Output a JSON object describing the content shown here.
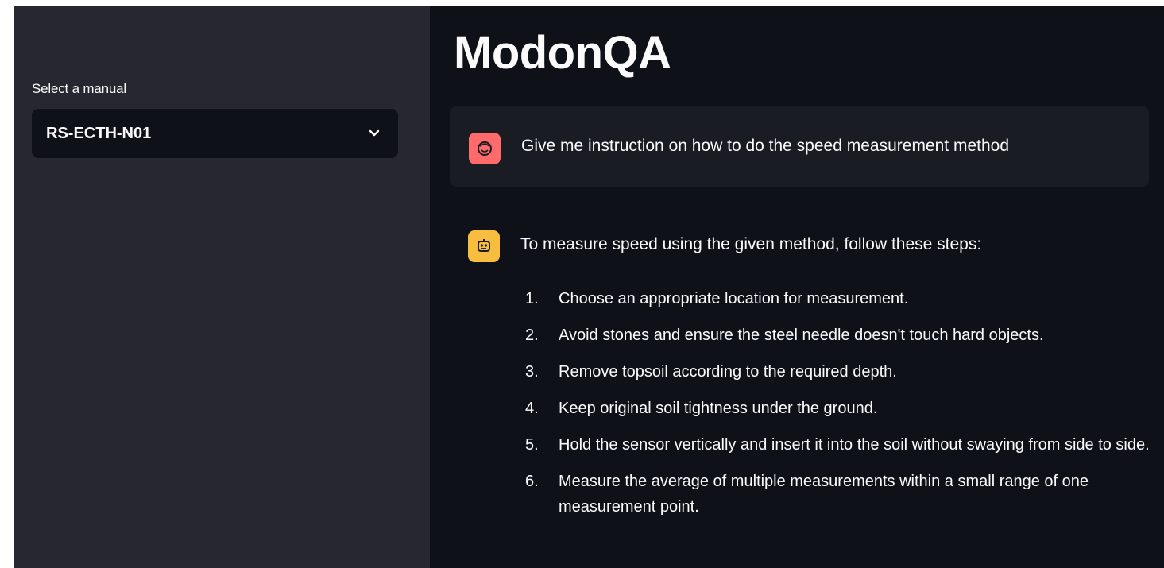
{
  "sidebar": {
    "select_label": "Select a manual",
    "selected_manual": "RS-ECTH-N01"
  },
  "main": {
    "title": "ModonQA",
    "messages": {
      "user": {
        "avatar_icon": "smiling-face-icon",
        "avatar_color": "#ff6b6b",
        "text": "Give me instruction on how to do the speed measurement method"
      },
      "assistant": {
        "avatar_icon": "robot-icon",
        "avatar_color": "#f6bd3f",
        "intro": "To measure speed using the given method, follow these steps:",
        "steps": [
          {
            "num": "1.",
            "text": "Choose an appropriate location for measurement."
          },
          {
            "num": "2.",
            "text": "Avoid stones and ensure the steel needle doesn't touch hard objects."
          },
          {
            "num": "3.",
            "text": "Remove topsoil according to the required depth."
          },
          {
            "num": "4.",
            "text": "Keep original soil tightness under the ground."
          },
          {
            "num": "5.",
            "text": "Hold the sensor vertically and insert it into the soil without swaying from side to side."
          },
          {
            "num": "6.",
            "text": "Measure the average of multiple measurements within a small range of one measurement point."
          }
        ]
      }
    }
  },
  "colors": {
    "sidebar_bg": "#262730",
    "main_bg": "#0e1117",
    "text": "#fafafa"
  }
}
